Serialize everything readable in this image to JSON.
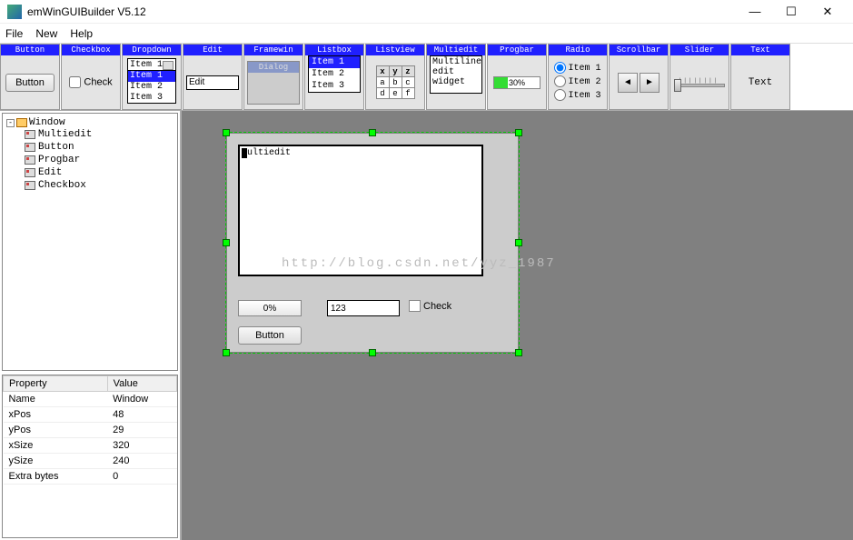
{
  "titlebar": {
    "title": "emWinGUIBuilder V5.12"
  },
  "menu": {
    "file": "File",
    "new": "New",
    "help": "Help"
  },
  "toolbox": {
    "button": {
      "title": "Button",
      "label": "Button"
    },
    "checkbox": {
      "title": "Checkbox",
      "label": "Check"
    },
    "dropdown": {
      "title": "Dropdown",
      "selected": "Item 1",
      "items": [
        "Item 1",
        "Item 2",
        "Item 3"
      ]
    },
    "edit": {
      "title": "Edit",
      "value": "Edit"
    },
    "framewin": {
      "title": "Framewin",
      "dialog": "Dialog"
    },
    "listbox": {
      "title": "Listbox",
      "items": [
        "Item 1",
        "Item 2",
        "Item 3"
      ]
    },
    "listview": {
      "title": "Listview",
      "cols": [
        "x",
        "y",
        "z"
      ],
      "rows": [
        [
          "a",
          "b",
          "c"
        ],
        [
          "d",
          "e",
          "f"
        ]
      ]
    },
    "multiedit": {
      "title": "Multiedit",
      "text": "Multiline edit widget"
    },
    "progbar": {
      "title": "Progbar",
      "label": "30%"
    },
    "radio": {
      "title": "Radio",
      "items": [
        "Item 1",
        "Item 2",
        "Item 3"
      ]
    },
    "scrollbar": {
      "title": "Scrollbar"
    },
    "slider": {
      "title": "Slider"
    },
    "text": {
      "title": "Text",
      "label": "Text"
    }
  },
  "tree": {
    "root": "Window",
    "children": [
      "Multiedit",
      "Button",
      "Progbar",
      "Edit",
      "Checkbox"
    ]
  },
  "properties": {
    "hdr_prop": "Property",
    "hdr_val": "Value",
    "rows": [
      {
        "k": "Name",
        "v": "Window"
      },
      {
        "k": "xPos",
        "v": "48"
      },
      {
        "k": "yPos",
        "v": "29"
      },
      {
        "k": "xSize",
        "v": "320"
      },
      {
        "k": "ySize",
        "v": "240"
      },
      {
        "k": "Extra bytes",
        "v": "0"
      }
    ]
  },
  "design": {
    "multiedit_text": "ultiedit",
    "progbar": "0%",
    "edit_value": "123",
    "check_label": "Check",
    "button_label": "Button"
  },
  "watermark": "http://blog.csdn.net/yyz_1987"
}
